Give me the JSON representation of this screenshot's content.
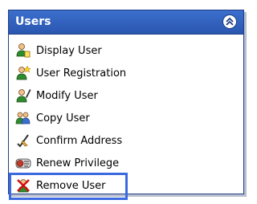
{
  "panel": {
    "title": "Users",
    "collapse_icon": "double-chevron-up-icon"
  },
  "menu": {
    "items": [
      {
        "label": "Display User",
        "icon": "user-search-icon"
      },
      {
        "label": "User Registration",
        "icon": "user-add-icon"
      },
      {
        "label": "Modify User",
        "icon": "user-edit-icon"
      },
      {
        "label": "Copy User",
        "icon": "users-copy-icon"
      },
      {
        "label": "Confirm Address",
        "icon": "address-confirm-icon"
      },
      {
        "label": "Renew Privilege",
        "icon": "renew-privilege-icon"
      },
      {
        "label": "Remove User",
        "icon": "user-remove-icon"
      }
    ]
  },
  "colors": {
    "header": "#2a56b0",
    "selection": "#3b6ae0"
  }
}
